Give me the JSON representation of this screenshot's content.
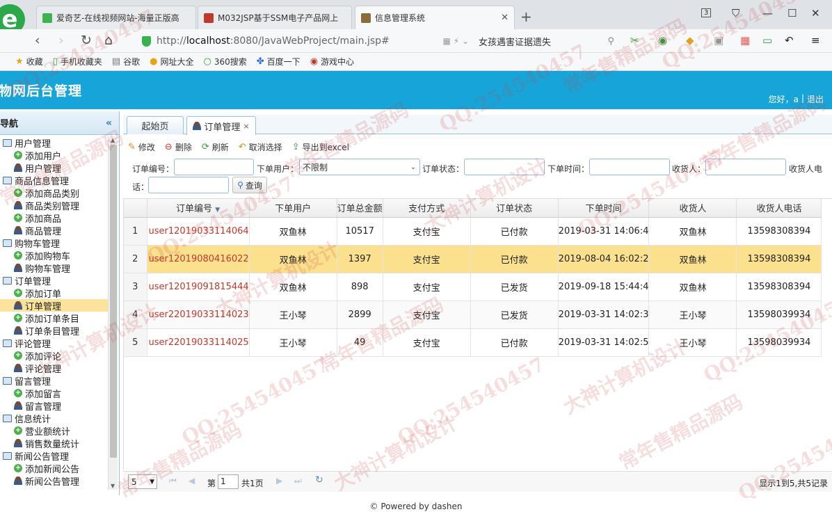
{
  "browser": {
    "tabs": [
      {
        "label": "爱奇艺-在线视频网站-海量正版高"
      },
      {
        "label": "M032JSP基于SSM电子产品网上"
      },
      {
        "label": "信息管理系统"
      }
    ],
    "new_tab_symbol": "+",
    "url_prefix": "http://",
    "url_host": "localhost",
    "url_rest": ":8080/JavaWebProject/main.jsp#",
    "search_text": "女孩遇害证据遗失",
    "tab_count": "3",
    "bookmarks": [
      "收藏",
      "手机收藏夹",
      "谷歌",
      "网址大全",
      "360搜索",
      "百度一下",
      "游戏中心"
    ]
  },
  "app": {
    "title": "物网后台管理",
    "greeting": "您好，a",
    "separator": "|",
    "logout": "退出"
  },
  "sidebar": {
    "title": "导航",
    "collapse_symbol": "«",
    "groups": [
      {
        "label": "用户管理",
        "items": [
          "添加用户",
          "用户管理"
        ]
      },
      {
        "label": "商品信息管理",
        "items": [
          "添加商品类别",
          "商品类别管理",
          "添加商品",
          "商品管理"
        ]
      },
      {
        "label": "购物车管理",
        "items": [
          "添加购物车",
          "购物车管理"
        ]
      },
      {
        "label": "订单管理",
        "items": [
          "添加订单",
          "订单管理",
          "添加订单条目",
          "订单条目管理"
        ]
      },
      {
        "label": "评论管理",
        "items": [
          "添加评论",
          "评论管理"
        ]
      },
      {
        "label": "留言管理",
        "items": [
          "添加留言",
          "留言管理"
        ]
      },
      {
        "label": "信息统计",
        "items": [
          "营业额统计",
          "销售数量统计"
        ]
      },
      {
        "label": "新闻公告管理",
        "items": [
          "添加新闻公告",
          "新闻公告管理"
        ]
      }
    ]
  },
  "tabs": [
    {
      "label": "起始页"
    },
    {
      "label": "订单管理",
      "close": "×"
    }
  ],
  "toolbar": {
    "edit": "修改",
    "delete": "删除",
    "refresh": "刷新",
    "unselect": "取消选择",
    "export": "导出到excel"
  },
  "filters": {
    "order_no": "订单编号：",
    "user": "下单用户：",
    "user_value": "不限制",
    "status": "订单状态：",
    "time": "下单时间：",
    "receiver": "收货人：",
    "phone_part1": "收货人电",
    "phone_part2": "话：",
    "query": "查询"
  },
  "grid": {
    "columns": [
      "订单编号",
      "下单用户",
      "订单总金额",
      "支付方式",
      "订单状态",
      "下单时间",
      "收货人",
      "收货人电话"
    ],
    "rows": [
      {
        "n": "1",
        "id": "user12019033114064",
        "user": "双鱼林",
        "total": "10517",
        "pay": "支付宝",
        "status": "已付款",
        "time": "2019-03-31 14:06:4",
        "recv": "双鱼林",
        "phone": "13598308394"
      },
      {
        "n": "2",
        "id": "user12019080416022",
        "user": "双鱼林",
        "total": "1397",
        "pay": "支付宝",
        "status": "已付款",
        "time": "2019-08-04 16:02:2",
        "recv": "双鱼林",
        "phone": "13598308394"
      },
      {
        "n": "3",
        "id": "user12019091815444",
        "user": "双鱼林",
        "total": "898",
        "pay": "支付宝",
        "status": "已发货",
        "time": "2019-09-18 15:44:4",
        "recv": "双鱼林",
        "phone": "13598308394"
      },
      {
        "n": "4",
        "id": "user22019033114023",
        "user": "王小琴",
        "total": "2899",
        "pay": "支付宝",
        "status": "已发货",
        "time": "2019-03-31 14:02:3",
        "recv": "王小琴",
        "phone": "13598039934"
      },
      {
        "n": "5",
        "id": "user22019033114025",
        "user": "王小琴",
        "total": "49",
        "pay": "支付宝",
        "status": "已付款",
        "time": "2019-03-31 14:02:5",
        "recv": "王小琴",
        "phone": "13598039934"
      }
    ]
  },
  "pager": {
    "page_size": "5",
    "page_prefix": "第",
    "page_value": "1",
    "page_total": "共1页",
    "summary": "显示1到5,共5记录"
  },
  "footer": "© Powered by dashen",
  "watermarks": [
    "QQ:254540457",
    "常年售精品源码",
    "大神计算机设计"
  ]
}
